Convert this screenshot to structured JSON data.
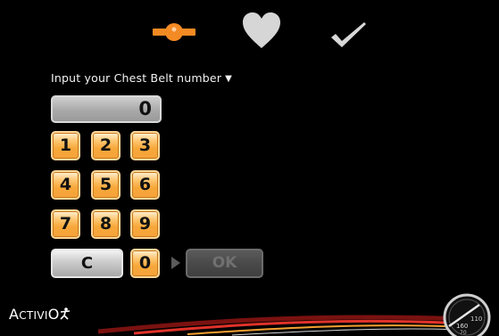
{
  "prompt": {
    "text": "Input your Chest Belt number",
    "arrow": "▼"
  },
  "display": {
    "value": "0"
  },
  "keypad": {
    "keys": [
      "1",
      "2",
      "3",
      "4",
      "5",
      "6",
      "7",
      "8",
      "9"
    ],
    "clear": "C",
    "zero": "0",
    "ok": "OK",
    "ok_enabled": false
  },
  "top_icons": [
    "chest-belt-icon",
    "heart-icon",
    "check-icon"
  ],
  "footer": {
    "logo_parts": [
      "A",
      "CTIVI",
      "O"
    ],
    "gauge_labels": [
      "160",
      "110",
      "70"
    ]
  },
  "colors": {
    "background": "#000000",
    "key_orange": "#f7a83a",
    "belt_orange": "#f48a23",
    "swoosh_red": "#e0322a"
  }
}
